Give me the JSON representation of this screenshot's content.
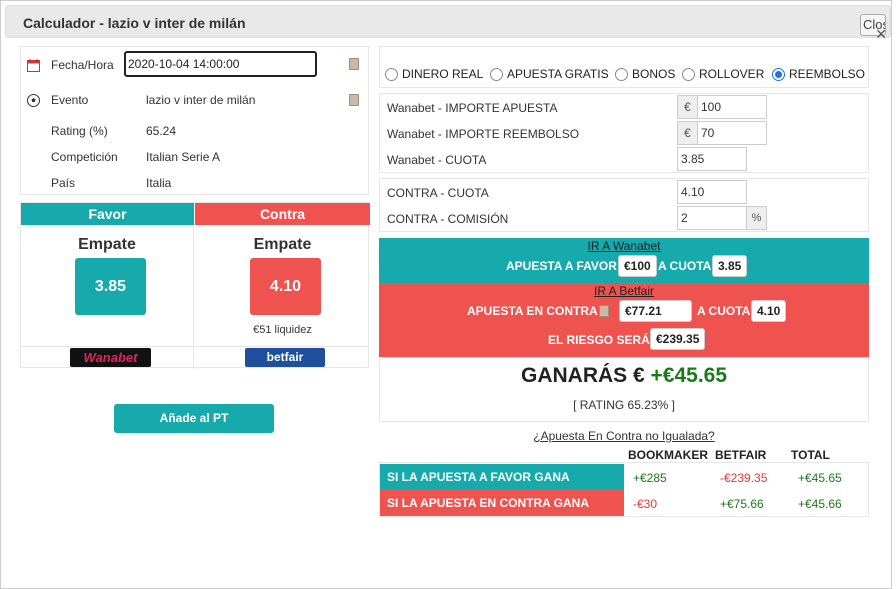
{
  "dialog": {
    "title": "Calculador - lazio v inter de milán",
    "close_label": "Close",
    "close_x": "✕"
  },
  "info": {
    "fecha_label": "Fecha/Hora",
    "fecha_value": "2020-10-04 14:00:00",
    "evento_label": "Evento",
    "evento_value": "lazio v inter de milán",
    "rating_label": "Rating (%)",
    "rating_value": "65.24",
    "competicion_label": "Competición",
    "competicion_value": "Italian Serie A",
    "pais_label": "País",
    "pais_value": "Italia"
  },
  "favor": {
    "header": "Favor",
    "selection": "Empate",
    "odds": "3.85",
    "bookmaker_logo": "Wanabet"
  },
  "contra": {
    "header": "Contra",
    "selection": "Empate",
    "odds": "4.10",
    "liquidity": "€51 liquidez",
    "exchange_logo": "betfair"
  },
  "add_pt_button": "Añade al PT",
  "modes": [
    {
      "label": "DINERO REAL",
      "checked": false
    },
    {
      "label": "APUESTA GRATIS",
      "checked": false
    },
    {
      "label": "BONOS",
      "checked": false
    },
    {
      "label": "ROLLOVER",
      "checked": false
    },
    {
      "label": "REEMBOLSO",
      "checked": true
    }
  ],
  "fields": {
    "importe_apuesta_label": "Wanabet - IMPORTE APUESTA",
    "importe_apuesta_value": "100",
    "importe_reembolso_label": "Wanabet - IMPORTE REEMBOLSO",
    "importe_reembolso_value": "70",
    "cuota_label": "Wanabet - CUOTA",
    "cuota_value": "3.85",
    "contra_cuota_label": "CONTRA - CUOTA",
    "contra_cuota_value": "4.10",
    "contra_comision_label": "CONTRA - COMISIÓN",
    "contra_comision_value": "2",
    "currency_symbol": "€",
    "percent_symbol": "%"
  },
  "instructions": {
    "go_wanabet": "IR A Wanabet",
    "apuesta_favor_text": "APUESTA A FAVOR",
    "apuesta_favor_amount": "€100",
    "a_cuota_text": "A CUOTA",
    "favor_cuota": "3.85",
    "go_betfair": "IR A Betfair",
    "apuesta_contra_text": "APUESTA EN CONTRA",
    "apuesta_contra_amount": "€77.21",
    "contra_cuota": "4.10",
    "riesgo_text": "EL RIESGO SERÁ",
    "riesgo_amount": "€239.35"
  },
  "result": {
    "ganaras_label": "GANARÁS €",
    "ganaras_value": "+€45.65",
    "rating_text": "[ RATING 65.23% ]"
  },
  "unmatched_link": "¿Apuesta En Contra no Igualada?",
  "table": {
    "headers": [
      "BOOKMAKER",
      "BETFAIR",
      "TOTAL"
    ],
    "rows": [
      {
        "label": "SI LA APUESTA A FAVOR GANA",
        "bookmaker": "+€285",
        "betfair": "-€239.35",
        "total": "+€45.65"
      },
      {
        "label": "SI LA APUESTA EN CONTRA GANA",
        "bookmaker": "-€30",
        "betfair": "+€75.66",
        "total": "+€45.66"
      }
    ]
  },
  "colors": {
    "teal": "#16aaac",
    "red": "#ef5350",
    "green": "#1a7a1a"
  }
}
